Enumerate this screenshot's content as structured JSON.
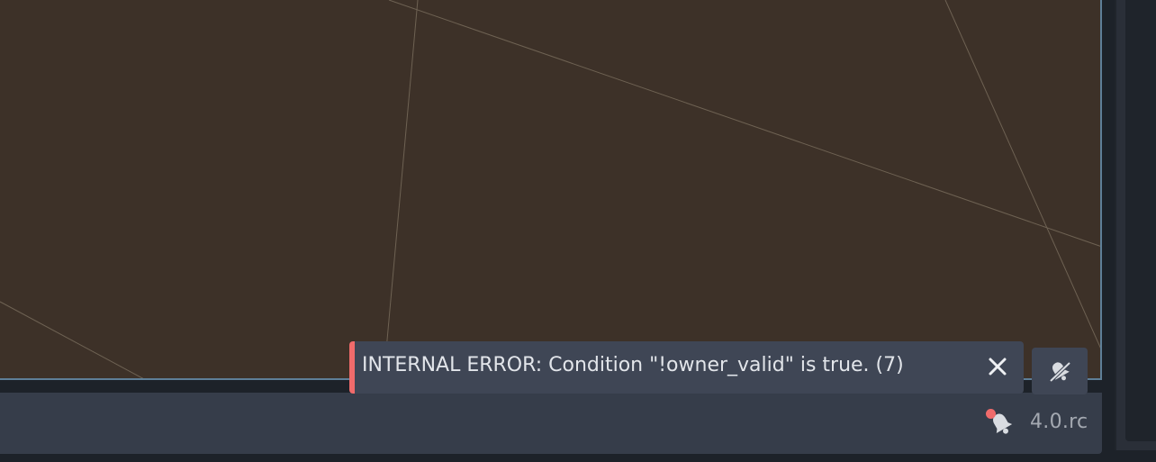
{
  "toast": {
    "message": "INTERNAL ERROR: Condition \"!owner_valid\" is true.  (7)",
    "severity_color": "#f06b6b"
  },
  "status_bar": {
    "version": "4.0.rc",
    "notifications_unread": true
  },
  "icons": {
    "close": "close-icon",
    "mute": "bell-muted-icon",
    "notification": "bell-icon"
  },
  "colors": {
    "viewport_bg": "#3d3128",
    "viewport_border": "#5e7f98",
    "panel_bg": "#363d4a",
    "toast_bg": "#3f4655",
    "error_accent": "#f06b6b"
  }
}
